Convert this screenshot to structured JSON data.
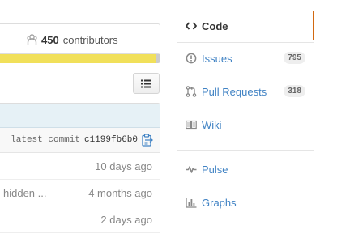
{
  "summary": {
    "contributors_count": "450",
    "contributors_label": "contributors"
  },
  "commit": {
    "label": "latest commit",
    "sha": "c1199fb6b0"
  },
  "files": [
    {
      "message": "",
      "age": "10 days ago"
    },
    {
      "message": "hidden ...",
      "age": "4 months ago"
    },
    {
      "message": "",
      "age": "2 days ago"
    }
  ],
  "nav": {
    "code": {
      "label": "Code",
      "icon": "code-icon"
    },
    "issues": {
      "label": "Issues",
      "count": "795",
      "icon": "issue-opened-icon"
    },
    "pulls": {
      "label": "Pull Requests",
      "count": "318",
      "icon": "git-pull-request-icon"
    },
    "wiki": {
      "label": "Wiki",
      "icon": "book-icon"
    },
    "pulse": {
      "label": "Pulse",
      "icon": "pulse-icon"
    },
    "graphs": {
      "label": "Graphs",
      "icon": "graph-icon"
    }
  },
  "colors": {
    "link": "#4183c4",
    "selected_accent": "#d26911",
    "language_primary": "#f1e05a",
    "language_other": "#cccccc",
    "commit_banner": "#e6f1f6"
  },
  "language_bar": {
    "primary_percent": 97.5
  }
}
